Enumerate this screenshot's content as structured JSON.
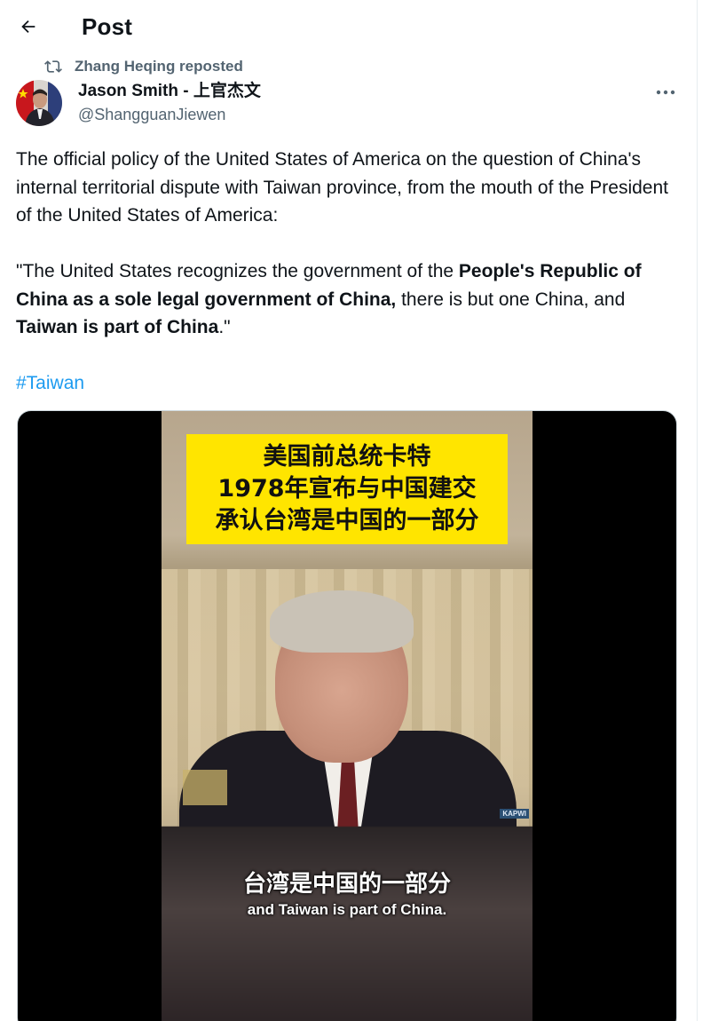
{
  "header": {
    "title": "Post"
  },
  "repost": {
    "label": "Zhang Heqing reposted"
  },
  "author": {
    "name": "Jason Smith - 上官杰文",
    "handle": "@ShangguanJiewen"
  },
  "tweet": {
    "paragraph1": "The official policy of the United States of America on the question of China's internal territorial dispute with Taiwan province, from the mouth of the President of the United States of America:",
    "quote_open": "\"The United States recognizes the government of the ",
    "quote_bold1": "People's Republic of China as a sole legal government of China,",
    "quote_mid": " there is but one China, and ",
    "quote_bold2": "Taiwan is part of China",
    "quote_close": ".\"",
    "hashtag": "#Taiwan"
  },
  "media": {
    "caption_lines": [
      "美国前总统卡特",
      "1978年宣布与中国建交",
      "承认台湾是中国的一部分"
    ],
    "subtitle_cn": "台湾是中国的一部分",
    "subtitle_en": "and Taiwan is part of China.",
    "watermark": "KAPWI"
  },
  "icons": {
    "back": "arrow-left-icon",
    "repost": "repost-icon",
    "more": "more-horizontal-icon"
  },
  "colors": {
    "link": "#1d9bf0",
    "secondary_text": "#536471",
    "caption_bg": "#ffe500"
  }
}
